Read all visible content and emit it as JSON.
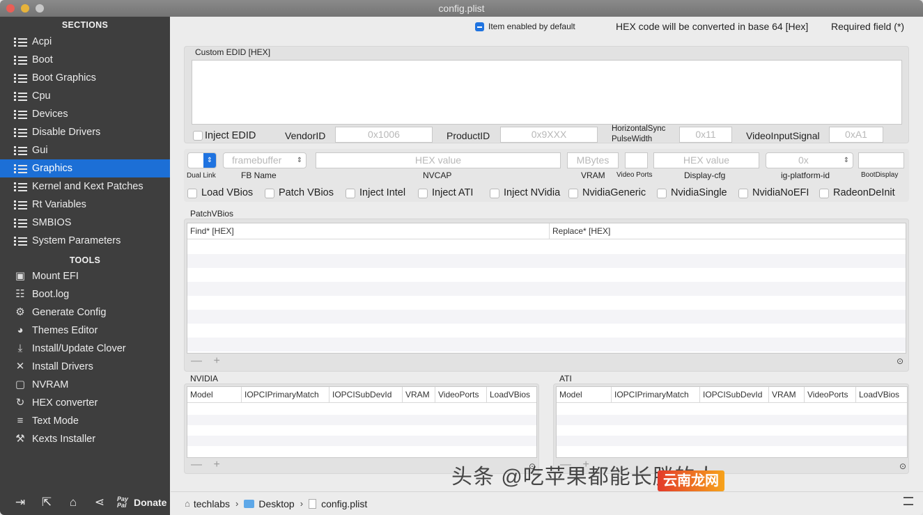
{
  "window": {
    "title": "config.plist"
  },
  "sidebar": {
    "sections_header": "SECTIONS",
    "sections": [
      {
        "label": "Acpi"
      },
      {
        "label": "Boot"
      },
      {
        "label": "Boot Graphics"
      },
      {
        "label": "Cpu"
      },
      {
        "label": "Devices"
      },
      {
        "label": "Disable Drivers"
      },
      {
        "label": "Gui"
      },
      {
        "label": "Graphics"
      },
      {
        "label": "Kernel and Kext Patches"
      },
      {
        "label": "Rt Variables"
      },
      {
        "label": "SMBIOS"
      },
      {
        "label": "System Parameters"
      }
    ],
    "tools_header": "TOOLS",
    "tools": [
      {
        "label": "Mount EFI",
        "icon": "disk-icon"
      },
      {
        "label": "Boot.log",
        "icon": "log-icon"
      },
      {
        "label": "Generate Config",
        "icon": "gears-icon"
      },
      {
        "label": "Themes Editor",
        "icon": "palette-icon"
      },
      {
        "label": "Install/Update Clover",
        "icon": "install-icon"
      },
      {
        "label": "Install Drivers",
        "icon": "tools-icon"
      },
      {
        "label": "NVRAM",
        "icon": "chip-icon"
      },
      {
        "label": "HEX converter",
        "icon": "refresh-icon"
      },
      {
        "label": "Text Mode",
        "icon": "text-lines-icon"
      },
      {
        "label": "Kexts Installer",
        "icon": "hammer-icon"
      }
    ],
    "footer": {
      "paypal_top": "Pay",
      "paypal_bottom": "Pal",
      "donate": "Donate"
    }
  },
  "header": {
    "enabled_hint": "Item enabled by default",
    "hex_note": "HEX code will be converted in base 64 [Hex]",
    "required_note": "Required field (*)"
  },
  "custom_edid": {
    "label": "Custom EDID [HEX]",
    "value": "",
    "inject_edid": "Inject EDID",
    "vendor_label": "VendorID",
    "vendor_placeholder": "0x1006",
    "product_label": "ProductID",
    "product_placeholder": "0x9XXX",
    "hsync_label_1": "HorizontalSync",
    "hsync_label_2": "PulseWidth",
    "hsync_placeholder": "0x11",
    "vis_label": "VideoInputSignal",
    "vis_placeholder": "0xA1"
  },
  "fb_row": {
    "dual_link": "Dual Link",
    "fb_placeholder": "framebuffer",
    "fb_name": "FB Name",
    "nvcap_placeholder": "HEX value",
    "nvcap": "NVCAP",
    "vram_placeholder": "MBytes",
    "vram": "VRAM",
    "video_ports": "Video Ports",
    "display_cfg_placeholder": "HEX value",
    "display_cfg": "Display-cfg",
    "ig_placeholder": "0x",
    "ig_platform": "ig-platform-id",
    "boot_display": "BootDisplay"
  },
  "checkboxes": [
    {
      "label": "Load VBios"
    },
    {
      "label": "Patch VBios"
    },
    {
      "label": "Inject Intel"
    },
    {
      "label": "Inject ATI"
    },
    {
      "label": "Inject NVidia"
    },
    {
      "label": "NvidiaGeneric"
    },
    {
      "label": "NvidiaSingle"
    },
    {
      "label": "NvidiaNoEFI"
    },
    {
      "label": "RadeonDeInit"
    }
  ],
  "patch_vbios": {
    "label": "PatchVBios",
    "columns": [
      "Find* [HEX]",
      "Replace* [HEX]"
    ],
    "footer": "— +"
  },
  "nvidia": {
    "label": "NVIDIA",
    "columns": [
      "Model",
      "IOPCIPrimaryMatch",
      "IOPCISubDevId",
      "VRAM",
      "VideoPorts",
      "LoadVBios"
    ],
    "footer": "— +"
  },
  "ati": {
    "label": "ATI",
    "columns": [
      "Model",
      "IOPCIPrimaryMatch",
      "IOPCISubDevId",
      "VRAM",
      "VideoPorts",
      "LoadVBios"
    ],
    "footer": "— +"
  },
  "pathbar": {
    "items": [
      "techlabs",
      "Desktop",
      "config.plist"
    ],
    "separator": "›"
  },
  "watermark": {
    "text": "头条 @吃苹果都能长胖的人",
    "badge": "云南龙网"
  },
  "colors": {
    "accent": "#1c6fd6",
    "sidebar_bg": "#3e3e3e"
  }
}
